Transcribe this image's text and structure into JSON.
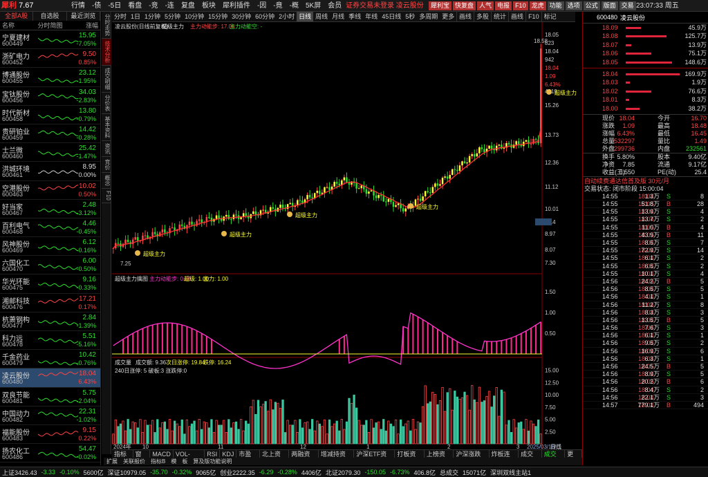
{
  "app": {
    "logo": "犀利",
    "version": "7.67"
  },
  "menu": [
    "行情",
    "-债",
    "-5日",
    "看盘",
    "-竞",
    "-连",
    "复盘",
    "板块",
    "犀利插件",
    "-因",
    "-竟",
    "-概",
    "5K屏",
    "会员"
  ],
  "notice": "证券交易未登录  凌云股份",
  "top_buttons": [
    "犀利宝",
    "快复盘",
    "人气",
    "电报",
    "F10",
    "龙虎",
    "功能",
    "选项",
    "公式",
    "版面",
    "交易"
  ],
  "clock": "23:07:33 周五",
  "left": {
    "tabs": [
      "全部A股",
      "自选股",
      "最近浏览"
    ],
    "col_name": "名称",
    "col_chart": "分时简图",
    "col_change": "涨幅",
    "stocks": [
      {
        "name": "宁夏建材",
        "code": "600449",
        "price": "15.95",
        "change": "-7.05%",
        "dir": "dn"
      },
      {
        "name": "浙矿电力",
        "code": "600452",
        "price": "9.50",
        "change": "0.85%",
        "dir": "up"
      },
      {
        "name": "博通股份",
        "code": "600455",
        "price": "23.12",
        "change": "-1.95%",
        "dir": "dn"
      },
      {
        "name": "宝钛股份",
        "code": "600456",
        "price": "34.03",
        "change": "-2.83%",
        "dir": "dn"
      },
      {
        "name": "时代新材",
        "code": "600458",
        "price": "13.80",
        "change": "-0.79%",
        "dir": "dn"
      },
      {
        "name": "贵研铂业",
        "code": "600459",
        "price": "14.42",
        "change": "-0.28%",
        "dir": "dn"
      },
      {
        "name": "士兰微",
        "code": "600460",
        "price": "25.42",
        "change": "-1.47%",
        "dir": "dn"
      },
      {
        "name": "洪城环境",
        "code": "600461",
        "price": "8.95",
        "change": "0.00%",
        "dir": "fl"
      },
      {
        "name": "空港股份",
        "code": "600463",
        "price": "10.02",
        "change": "0.50%",
        "dir": "up"
      },
      {
        "name": "好当家",
        "code": "600467",
        "price": "2.48",
        "change": "-3.12%",
        "dir": "dn"
      },
      {
        "name": "百利电气",
        "code": "600468",
        "price": "4.46",
        "change": "-0.45%",
        "dir": "dn"
      },
      {
        "name": "风神股份",
        "code": "600469",
        "price": "6.12",
        "change": "-0.16%",
        "dir": "dn"
      },
      {
        "name": "六国化工",
        "code": "600470",
        "price": "6.00",
        "change": "-0.50%",
        "dir": "dn"
      },
      {
        "name": "华光环能",
        "code": "600475",
        "price": "9.16",
        "change": "-0.33%",
        "dir": "dn"
      },
      {
        "name": "湘邮科技",
        "code": "600476",
        "price": "17.21",
        "change": "0.17%",
        "dir": "up"
      },
      {
        "name": "杭萧钢构",
        "code": "600477",
        "price": "2.84",
        "change": "-1.39%",
        "dir": "dn"
      },
      {
        "name": "科力远",
        "code": "600478",
        "price": "5.51",
        "change": "-5.16%",
        "dir": "dn"
      },
      {
        "name": "千金药业",
        "code": "600479",
        "price": "10.42",
        "change": "-0.76%",
        "dir": "dn"
      },
      {
        "name": "凌云股份",
        "code": "600480",
        "price": "18.04",
        "change": "6.43%",
        "dir": "up",
        "selected": true
      },
      {
        "name": "双良节能",
        "code": "600481",
        "price": "5.75",
        "change": "-2.04%",
        "dir": "dn"
      },
      {
        "name": "中国动力",
        "code": "600482",
        "price": "22.31",
        "change": "-1.02%",
        "dir": "dn"
      },
      {
        "name": "福能股份",
        "code": "600483",
        "price": "9.15",
        "change": "0.22%",
        "dir": "up"
      },
      {
        "name": "扬农化工",
        "code": "600486",
        "price": "54.47",
        "change": "-0.02%",
        "dir": "dn"
      }
    ]
  },
  "vertical_tabs": [
    "分时走势",
    "技术分析",
    "成交明细",
    "分价表",
    "基本资料",
    "资讯",
    "竞价",
    "概念",
    "F10"
  ],
  "period_tabs": [
    "分时",
    "1日",
    "1分钟",
    "5分钟",
    "10分钟",
    "15分钟",
    "30分钟",
    "60分钟",
    "2小时",
    "日线",
    "周线",
    "月线",
    "季线",
    "年线",
    "45日线",
    "5秒",
    "多周期",
    "更多"
  ],
  "period_selected": "日线",
  "right_chart_tabs": [
    "画线",
    "多股",
    "统计",
    "画线",
    "F10",
    "标记"
  ],
  "chart": {
    "main_title": "凌云股份(日线前复权)",
    "main_indicator": "超级主力",
    "main_legend_red": "主力动能步: 17.04",
    "main_legend_green": "主力动能空: -",
    "price_labels": [
      "18.05",
      "823",
      "18.04",
      "942",
      "18.04",
      "1.09",
      "6.43%",
      "4319",
      "15.26",
      "13.73",
      "12.36",
      "11.12",
      "10.01",
      "9.14",
      "8.97",
      "8.07",
      "7.30"
    ],
    "high_mark": "18.58",
    "low_mark": "7.25",
    "signal_label": "超级主力",
    "sub_title": "超级主力擒图",
    "sub_l1": "主力动能步: 0.66",
    "sub_l2": "超级: 1.00",
    "sub_l3": "主力: 1.00",
    "sub_axis": [
      "1.50",
      "1.00",
      "0.50"
    ],
    "vol_title": "成交量",
    "vol_l1": "成交额: 9.36",
    "vol_l2": "次日涨停: 19.84",
    "vol_l3": "跌停: 16.24",
    "vol_info": "240日涨停: 5 破板:3 涨跌停:0",
    "vol_axis": [
      "15.00",
      "12.50",
      "10.00",
      "7.50",
      "5.00",
      "2.50"
    ],
    "x_labels": [
      "2024年",
      "10",
      "11",
      "12",
      "1",
      "2",
      "3",
      "2025/03/18/二"
    ],
    "right_label": "日线"
  },
  "bottom_tabs": [
    "指标A",
    "窗口",
    "MACD",
    "VOL-TDX",
    "RSI",
    "KDJ",
    "市盈率",
    "北上资金",
    "两融资金",
    "增减持资金",
    "沪深ETF资金",
    "打板资金",
    "上榜资金",
    "沪深涨跌停",
    "炸板连板",
    "成交量",
    "成交额",
    "更多"
  ],
  "bottom_selected": "成交额",
  "extra_row": [
    "扩展",
    "关联报价",
    "指标B",
    "模",
    "板",
    "算及版功能说明"
  ],
  "right": {
    "code": "600480",
    "name": "凌云股份",
    "asks": [
      {
        "p": "18.09",
        "v": "45.9万",
        "w": 0.28
      },
      {
        "p": "18.08",
        "v": "125.7万",
        "w": 0.75
      },
      {
        "p": "18.07",
        "v": "13.9万",
        "w": 0.1
      },
      {
        "p": "18.06",
        "v": "75.1万",
        "w": 0.47
      },
      {
        "p": "18.05",
        "v": "148.6万",
        "w": 0.86
      }
    ],
    "bids": [
      {
        "p": "18.04",
        "v": "169.9万",
        "w": 1.0
      },
      {
        "p": "18.03",
        "v": "1.9万",
        "w": 0.08
      },
      {
        "p": "18.02",
        "v": "76.6万",
        "w": 0.47
      },
      {
        "p": "18.01",
        "v": "8.3万",
        "w": 0.07
      },
      {
        "p": "18.00",
        "v": "38.2万",
        "w": 0.25
      }
    ],
    "stats": [
      [
        "现价",
        "18.04",
        "今开",
        "16.70"
      ],
      [
        "涨跌",
        "1.09",
        "最高",
        "18.48"
      ],
      [
        "涨幅",
        "6.43%",
        "最低",
        "16.45"
      ],
      [
        "总量",
        "532297",
        "量比",
        "1.49"
      ],
      [
        "外盘",
        "299736",
        "内盘",
        "232561"
      ],
      [
        "换手",
        "5.80%",
        "股本",
        "9.40亿"
      ],
      [
        "净资",
        "7.85",
        "流通",
        "9.17亿"
      ],
      [
        "收益(三)",
        "0.550",
        "PE(动)",
        "25.4"
      ]
    ],
    "finance_link": "自动续费通达信首及版  30元/月",
    "trade_status": "交易状态: 闭市阶段 15:00:04",
    "ticks": [
      [
        "14:55",
        "18.04",
        "1.3万",
        "S",
        "8"
      ],
      [
        "14:55",
        "18.05",
        "51.8万",
        "B",
        "28"
      ],
      [
        "14:55",
        "18.04",
        "13.9万",
        "S",
        "4"
      ],
      [
        "14:55",
        "18.04",
        "13.7万",
        "S",
        "2"
      ],
      [
        "14:55",
        "18.05",
        "11.0万",
        "B",
        "4"
      ],
      [
        "14:55",
        "18.05",
        "43.9万",
        "B",
        "11"
      ],
      [
        "14:55",
        "18.04",
        "8.5万",
        "S",
        "7"
      ],
      [
        "14:55",
        "18.04",
        "72.9万",
        "S",
        "14"
      ],
      [
        "14:55",
        "18.04",
        "6.1万",
        "S",
        "2"
      ],
      [
        "14:55",
        "18.04",
        "6.5万",
        "S",
        "2"
      ],
      [
        "14:55",
        "18.04",
        "10.1万",
        "S",
        "4"
      ],
      [
        "14:56",
        "18.05",
        "24.2万",
        "B",
        "5"
      ],
      [
        "14:56",
        "18.04",
        "8.5万",
        "S",
        "5"
      ],
      [
        "14:56",
        "18.04",
        "4.1万",
        "S",
        "1"
      ],
      [
        "14:56",
        "18.04",
        "11.2万",
        "S",
        "8"
      ],
      [
        "14:56",
        "18.04",
        "8.3万",
        "S",
        "3"
      ],
      [
        "14:56",
        "18.04",
        "13.5万",
        "B",
        "5"
      ],
      [
        "14:56",
        "18.04",
        "7.6万",
        "S",
        "3"
      ],
      [
        "14:56",
        "18.04",
        "6.1万",
        "S",
        "1"
      ],
      [
        "14:56",
        "18.04",
        "9.5万",
        "S",
        "2"
      ],
      [
        "14:56",
        "18.04",
        "16.9万",
        "S",
        "6"
      ],
      [
        "14:56",
        "18.04",
        "6.3万",
        "S",
        "1"
      ],
      [
        "14:56",
        "18.05",
        "24.5万",
        "B",
        "5"
      ],
      [
        "14:56",
        "18.04",
        "8.9万",
        "S",
        "5"
      ],
      [
        "14:56",
        "18.05",
        "20.2万",
        "B",
        "6"
      ],
      [
        "14:56",
        "18.04",
        "8.4万",
        "S",
        "2"
      ],
      [
        "14:56",
        "18.04",
        "22.1万",
        "S",
        "3"
      ],
      [
        "14:57",
        "18.04",
        "779.1万",
        "B",
        "494"
      ]
    ],
    "tail_tabs": [
      "笔",
      "价",
      "细",
      "势",
      "联",
      "值",
      "主",
      "筹"
    ]
  },
  "status": {
    "sh": "上证3426.43",
    "sh_chg": "-3.33",
    "sh_pct": "-0.10%",
    "sh_amt": "5600亿",
    "sz": "深证10979.05",
    "sz_chg": "-35.70",
    "sz_pct": "-0.32%",
    "sz_amt": "9065亿",
    "cy": "创业2222.35",
    "cy_chg": "-6.29",
    "cy_pct": "-0.28%",
    "cy_amt": "4406亿",
    "bz": "北证2079.30",
    "bz_chg": "-150.05",
    "bz_pct": "-6.73%",
    "bz_amt": "406.8亿",
    "total": "总成交",
    "total_v": "15071亿",
    "site": "深圳双线主站1"
  },
  "colors": {
    "up": "#ff4545",
    "down": "#2ee02e",
    "accent": "#8b0000",
    "yellow": "#ffff33",
    "magenta": "#ff33cc"
  }
}
